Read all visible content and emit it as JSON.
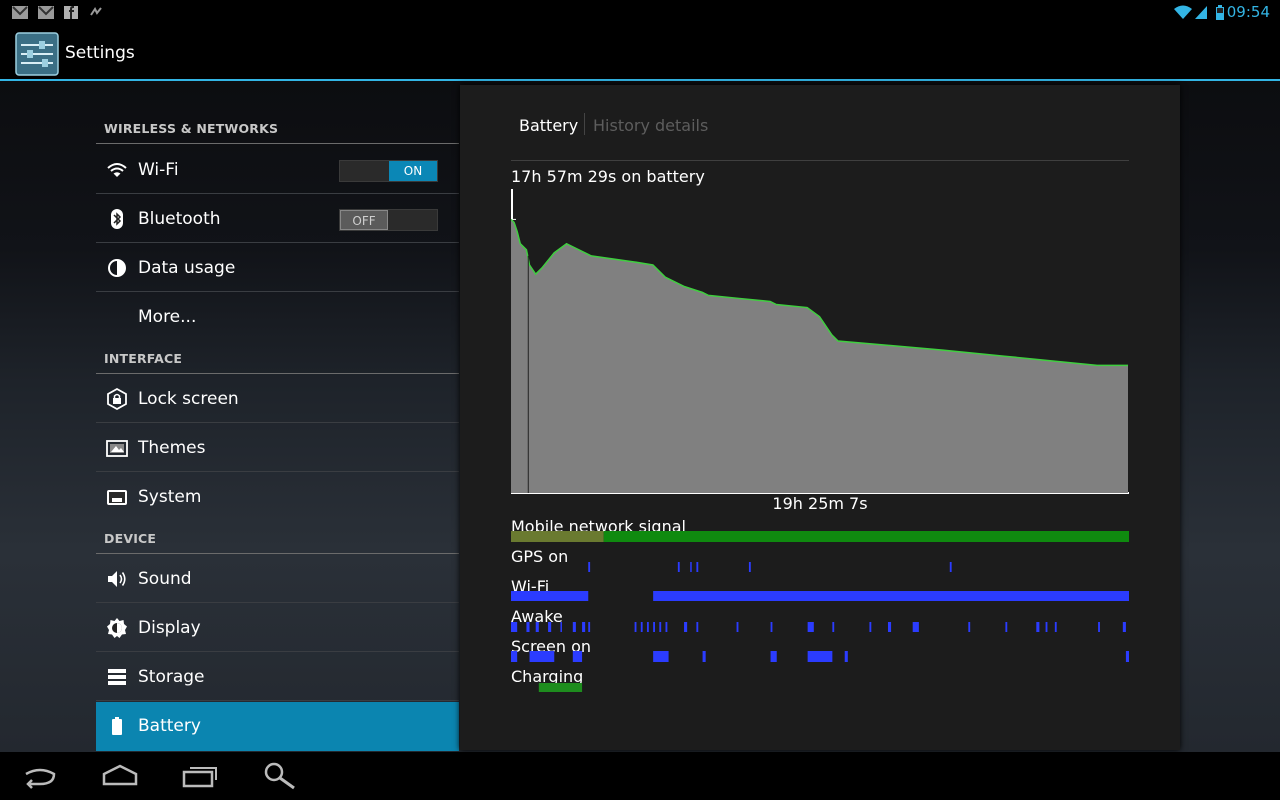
{
  "status_bar": {
    "time": "09:54",
    "notification_icons": [
      "gmail-icon",
      "gmail-icon",
      "facebook-icon",
      "sync-icon"
    ],
    "system_icons": [
      "wifi-icon",
      "signal-icon",
      "battery-icon"
    ]
  },
  "action_bar": {
    "title": "Settings",
    "icon": "settings-app-icon"
  },
  "sidebar": {
    "sections": [
      {
        "header": "WIRELESS & NETWORKS",
        "items": [
          {
            "label": "Wi-Fi",
            "icon": "wifi-icon",
            "toggle": "ON"
          },
          {
            "label": "Bluetooth",
            "icon": "bluetooth-icon",
            "toggle": "OFF"
          },
          {
            "label": "Data usage",
            "icon": "data-usage-icon"
          },
          {
            "label": "More...",
            "icon": ""
          }
        ]
      },
      {
        "header": "INTERFACE",
        "items": [
          {
            "label": "Lock screen",
            "icon": "lock-icon"
          },
          {
            "label": "Themes",
            "icon": "themes-icon"
          },
          {
            "label": "System",
            "icon": "system-icon"
          }
        ]
      },
      {
        "header": "DEVICE",
        "items": [
          {
            "label": "Sound",
            "icon": "speaker-icon"
          },
          {
            "label": "Display",
            "icon": "brightness-icon"
          },
          {
            "label": "Storage",
            "icon": "storage-icon"
          },
          {
            "label": "Battery",
            "icon": "battery-icon",
            "selected": true
          }
        ]
      }
    ]
  },
  "battery_panel": {
    "tabs": {
      "active": "Battery",
      "inactive": "History details"
    },
    "on_battery": "17h 57m 29s on battery",
    "duration": "19h 25m 7s",
    "tracks": [
      "Mobile network signal",
      "GPS on",
      "Wi-Fi",
      "Awake",
      "Screen on",
      "Charging"
    ]
  },
  "chart_data": {
    "type": "area",
    "title": "17h 57m 29s on battery",
    "xlabel": "19h 25m 7s",
    "ylabel": "",
    "ylim": [
      0,
      100
    ],
    "grid": false,
    "series": [
      {
        "values_x": [
          0.0,
          0.005,
          0.01,
          0.015,
          0.025,
          0.03,
          0.04,
          0.05,
          0.07,
          0.09,
          0.1,
          0.13,
          0.2,
          0.23,
          0.25,
          0.28,
          0.31,
          0.32,
          0.37,
          0.42,
          0.43,
          0.48,
          0.5,
          0.52,
          0.53,
          0.7,
          0.8,
          0.95,
          1.0
        ],
        "values": [
          90,
          89,
          86,
          82,
          80,
          75,
          72,
          74,
          79,
          82,
          81,
          78,
          76,
          75,
          71,
          68,
          66,
          65,
          64,
          63,
          62,
          61,
          58,
          52,
          50,
          47,
          45,
          42,
          42
        ]
      }
    ],
    "tracks": {
      "mobile_signal": [
        [
          0.0,
          0.15,
          "mixed"
        ],
        [
          0.15,
          1.0,
          "strong"
        ]
      ],
      "gps": [
        [
          0.125,
          0.128
        ],
        [
          0.27,
          0.273
        ],
        [
          0.29,
          0.292
        ],
        [
          0.3,
          0.303
        ],
        [
          0.385,
          0.388
        ],
        [
          0.71,
          0.713
        ]
      ],
      "wifi": [
        [
          0.0,
          0.125
        ],
        [
          0.23,
          1.0
        ]
      ],
      "awake": [
        [
          0.0,
          0.01
        ],
        [
          0.025,
          0.03
        ],
        [
          0.04,
          0.045
        ],
        [
          0.06,
          0.065
        ],
        [
          0.08,
          0.082
        ],
        [
          0.1,
          0.105
        ],
        [
          0.115,
          0.12
        ],
        [
          0.125,
          0.128
        ],
        [
          0.2,
          0.203
        ],
        [
          0.21,
          0.213
        ],
        [
          0.22,
          0.223
        ],
        [
          0.23,
          0.233
        ],
        [
          0.24,
          0.243
        ],
        [
          0.25,
          0.253
        ],
        [
          0.28,
          0.285
        ],
        [
          0.3,
          0.303
        ],
        [
          0.365,
          0.368
        ],
        [
          0.42,
          0.423
        ],
        [
          0.48,
          0.49
        ],
        [
          0.52,
          0.523
        ],
        [
          0.58,
          0.583
        ],
        [
          0.61,
          0.615
        ],
        [
          0.65,
          0.66
        ],
        [
          0.74,
          0.743
        ],
        [
          0.8,
          0.803
        ],
        [
          0.85,
          0.855
        ],
        [
          0.865,
          0.868
        ],
        [
          0.88,
          0.883
        ],
        [
          0.95,
          0.953
        ],
        [
          0.99,
          0.995
        ]
      ],
      "screen_on": [
        [
          0.0,
          0.01
        ],
        [
          0.03,
          0.07
        ],
        [
          0.1,
          0.115
        ],
        [
          0.23,
          0.255
        ],
        [
          0.31,
          0.315
        ],
        [
          0.42,
          0.43
        ],
        [
          0.48,
          0.52
        ],
        [
          0.54,
          0.545
        ],
        [
          0.995,
          1.0
        ]
      ],
      "charging": [
        [
          0.045,
          0.115
        ]
      ]
    }
  }
}
